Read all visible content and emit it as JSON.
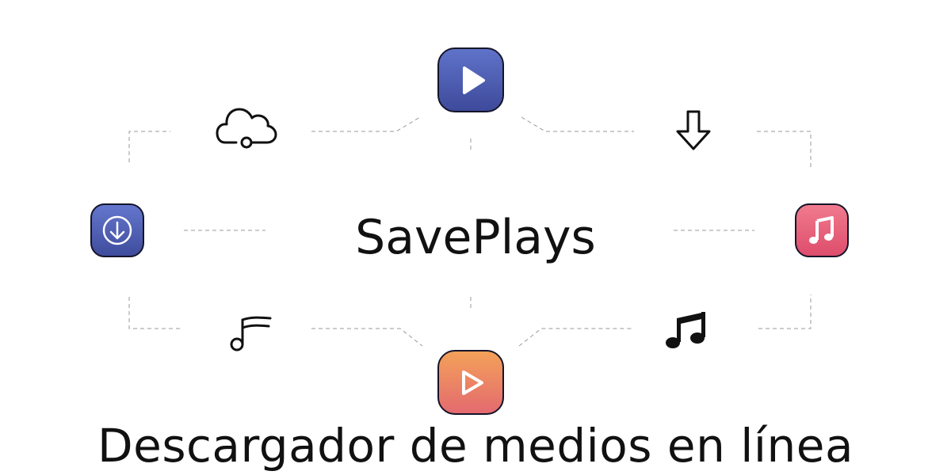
{
  "brand": {
    "name": "SavePlays"
  },
  "tagline": "Descargador de medios en línea",
  "icons": {
    "top_center": "play-tile-icon",
    "bottom_center": "play-tile-icon",
    "left_tile": "download-tile-icon",
    "right_tile": "music-note-tile-icon",
    "top_left_outline": "cloud-icon",
    "top_right_outline": "download-arrow-icon",
    "bottom_left_outline": "music-note-icon",
    "bottom_right_outline": "music-notes-icon"
  },
  "colors": {
    "play_blue": "#4b5bb0",
    "play_orange": "#eb8366",
    "download_blue": "#5060b5",
    "music_pink": "#e66079",
    "text": "#111111"
  }
}
